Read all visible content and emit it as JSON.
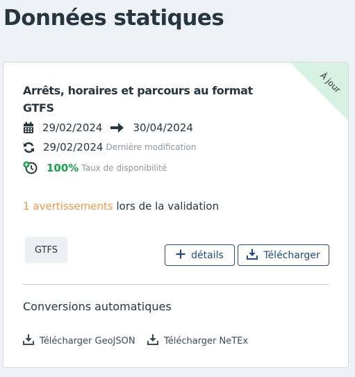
{
  "page": {
    "title": "Données statiques"
  },
  "resource": {
    "status_ribbon": "À jour",
    "title": "Arrêts, horaires et parcours au format GTFS",
    "start_date": "29/02/2024",
    "end_date": "30/04/2024",
    "modified_date": "29/02/2024",
    "modified_label": "Dernière modification",
    "availability_value": "100%",
    "availability_label": "Taux de disponibilité",
    "validation_warning": "1 avertissements",
    "validation_suffix": " lors de la validation",
    "format": "GTFS",
    "details_label": "détails",
    "download_label": "Télécharger"
  },
  "conversions": {
    "title": "Conversions automatiques",
    "items": [
      {
        "label": "Télécharger GeoJSON"
      },
      {
        "label": "Télécharger NeTEx"
      }
    ]
  },
  "colors": {
    "primary": "#234a84",
    "success": "#18a34a",
    "warning": "#f3964a",
    "ribbon": "#d7f2e2"
  },
  "icons": [
    "calendar-icon",
    "arrow-right-icon",
    "sync-icon",
    "history-icon",
    "plus-icon",
    "download-icon"
  ]
}
